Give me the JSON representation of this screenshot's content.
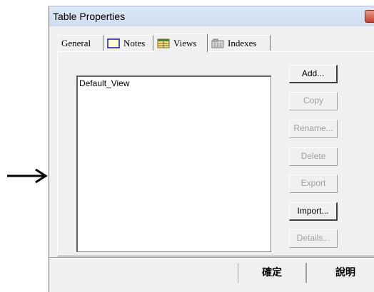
{
  "window": {
    "title": "Table Properties",
    "close_label": "x"
  },
  "tabs": [
    {
      "label": "General",
      "icon": "none",
      "active": false
    },
    {
      "label": "Notes",
      "icon": "note-icon",
      "active": false
    },
    {
      "label": "Views",
      "icon": "views-grid-icon",
      "active": true
    },
    {
      "label": "Indexes",
      "icon": "indexes-icon",
      "active": false
    }
  ],
  "views_list": {
    "items": [
      "Default_View"
    ]
  },
  "buttons": {
    "add": "Add...",
    "copy": "Copy",
    "rename": "Rename...",
    "delete": "Delete",
    "export": "Export",
    "import": "Import...",
    "details": "Details..."
  },
  "footer": {
    "ok_label": "確定",
    "help_label": "說明"
  },
  "colors": {
    "close_button": "#c4432b",
    "dialog_bg": "#f0f0f0",
    "disabled_text": "#a0a0a0"
  }
}
